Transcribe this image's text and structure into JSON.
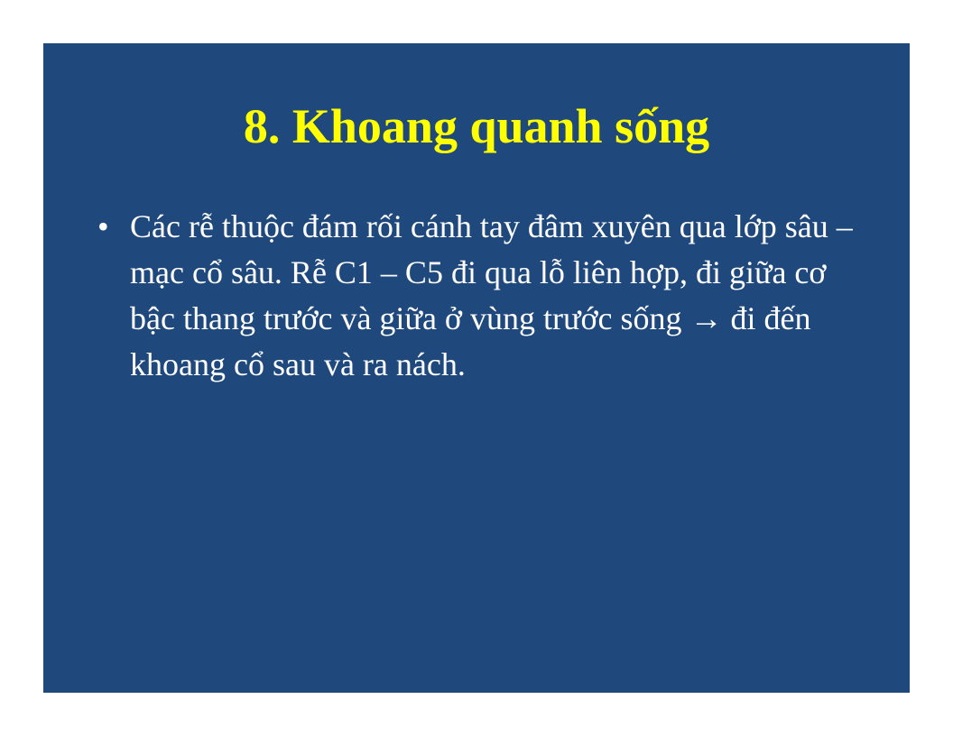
{
  "slide": {
    "background_color": "#1f497d",
    "title": "8. Khoang quanh sống",
    "title_color": "#ffff00",
    "bullets": [
      {
        "marker": "•",
        "text": "Các rễ thuộc đám rối cánh tay đâm xuyên qua lớp sâu – mạc cổ sâu. Rễ C1 – C5 đi qua lỗ liên hợp, đi giữa cơ bậc thang trước và giữa ở vùng trước sống → đi đến khoang cổ sau và ra nách."
      }
    ]
  }
}
